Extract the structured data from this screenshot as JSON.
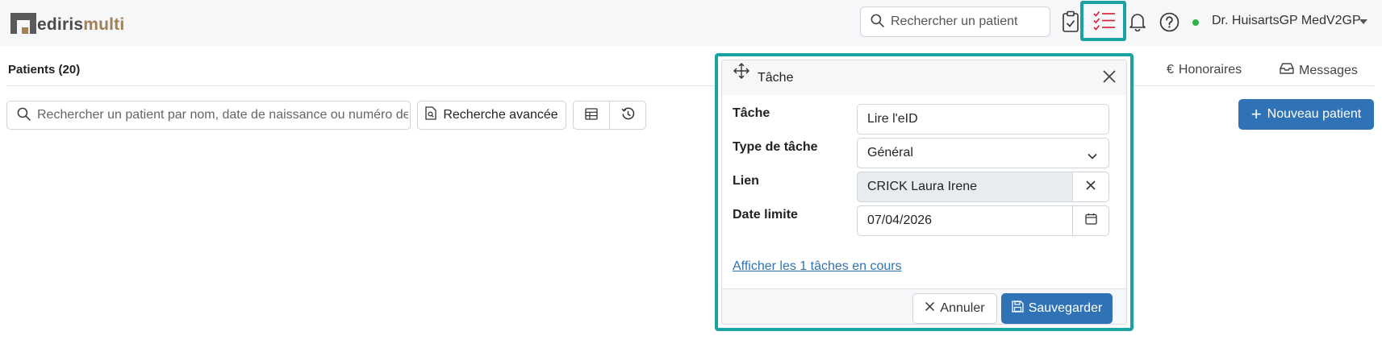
{
  "app": {
    "logo_part1": "edirismulti",
    "logo_initial": "M"
  },
  "topbar": {
    "search_placeholder": "Rechercher un patient",
    "user_name": "Dr. HuisartsGP MedV2GP",
    "icons": [
      "clipboard-check-icon",
      "task-list-icon",
      "bell-icon",
      "help-icon",
      "user-status-dot-icon",
      "caret-down-icon"
    ],
    "accent_color": "#1aa3a3",
    "status_color": "#2fb344"
  },
  "page": {
    "title": "Patients (20)",
    "tabs": [
      {
        "label": "Honoraires",
        "icon": "euro-icon"
      },
      {
        "label": "Messages",
        "icon": "inbox-icon"
      }
    ],
    "patient_search_placeholder": "Rechercher un patient par nom, date de naissance ou numéro de",
    "advanced_search_label": "Recherche avancée",
    "new_patient_label": "Nouveau patient",
    "primary_color": "#2f73b6"
  },
  "modal": {
    "title": "Tâche",
    "fields": {
      "task_label": "Tâche",
      "task_value": "Lire l'eID",
      "type_label": "Type de tâche",
      "type_value": "Général",
      "link_label": "Lien",
      "link_value": "CRICK Laura Irene",
      "due_label": "Date limite",
      "due_value": "07/04/2026"
    },
    "show_tasks_link": "Afficher les 1 tâches en cours",
    "cancel_label": "Annuler",
    "save_label": "Sauvegarder"
  }
}
